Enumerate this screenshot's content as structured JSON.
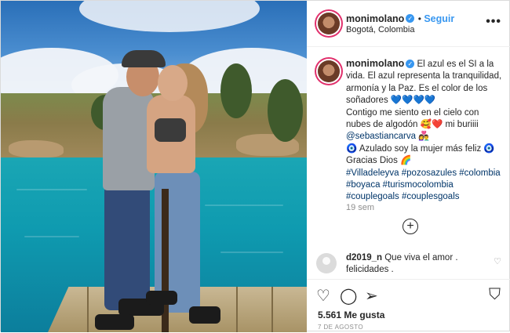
{
  "post": {
    "username": "monimolano",
    "follow_label": "Seguir",
    "location": "Bogotá, Colombia",
    "more_icon": "more-options-icon",
    "caption": {
      "line1_rest": " El azul es el SI a la vida. El azul representa la tranquilidad, armonía y la Paz. Es el color de los soñadores 💙💙💙💙",
      "line2": "Contigo me siento en el cielo con nubes de algodón 🥰❤️ mi buriiii ",
      "mention": "@sebastiancarva",
      "line2_tail": " 👩‍❤️‍👨",
      "line3": "🧿 Azulado soy la mujer más feliz 🧿",
      "line4": "Gracias Dios 🌈",
      "hashtags1": "#Villadeleyva #pozosazules #colombia",
      "hashtags2": "#boyaca #turismocolombia",
      "hashtags3": "#couplegoals #couplesgoals"
    },
    "time_ago": "19 sem",
    "add_icon": "+",
    "comments": [
      {
        "user": "d2019_n",
        "text": " Que viva el amor . felicidades ."
      }
    ],
    "likes": "5.561 Me gusta",
    "date": "7 DE AGOSTO"
  },
  "colors": {
    "link_blue": "#3897f0",
    "hashtag": "#003569",
    "muted": "#8e8e8e"
  }
}
